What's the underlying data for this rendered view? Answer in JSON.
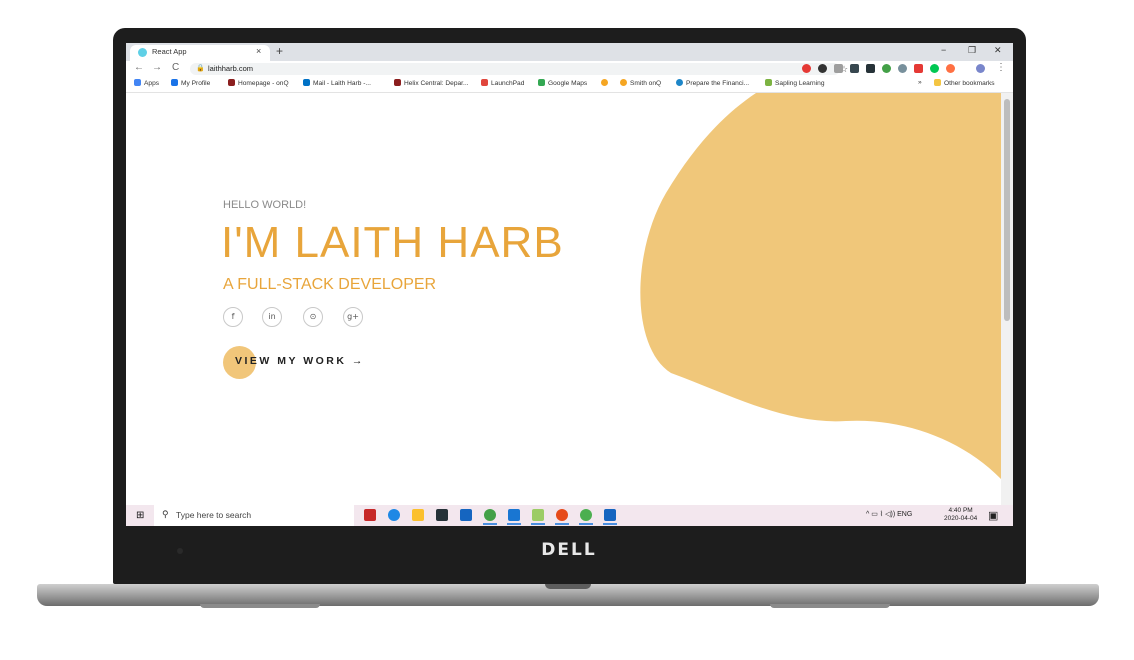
{
  "device": {
    "brand": "DELL"
  },
  "browser": {
    "tab_title": "React App",
    "tab_close": "×",
    "new_tab": "+",
    "window_controls": {
      "minimize": "−",
      "restore": "❐",
      "close": "✕"
    },
    "nav": {
      "back": "←",
      "forward": "→",
      "reload": "C"
    },
    "url": "laithharb.com",
    "bookmarks": [
      {
        "label": "Apps",
        "color": "#4285f4"
      },
      {
        "label": "My Profile",
        "color": "#1a73e8"
      },
      {
        "label": "Homepage - onQ",
        "color": "#8b1e1e"
      },
      {
        "label": "Mail - Laith Harb -...",
        "color": "#0072c6"
      },
      {
        "label": "Helix Central: Depar...",
        "color": "#8b1e1e"
      },
      {
        "label": "LaunchPad",
        "color": "#e0463c"
      },
      {
        "label": "Google Maps",
        "color": "#34a853"
      },
      {
        "label": "Smith onQ",
        "color": "#f5a623"
      },
      {
        "label": "Prepare the Financi...",
        "color": "#1d86c8"
      },
      {
        "label": "Sapling Learning",
        "color": "#7cb342"
      }
    ],
    "bookmarks_more": "»",
    "other_bookmarks": "Other bookmarks",
    "other_bookmarks_color": "#f4c542"
  },
  "page": {
    "greeting": "HELLO WORLD!",
    "name": "I'M LAITH HARB",
    "role": "A FULL-STACK DEVELOPER",
    "social": [
      {
        "icon": "facebook-icon",
        "glyph": "f"
      },
      {
        "icon": "linkedin-icon",
        "glyph": "in"
      },
      {
        "icon": "github-icon",
        "glyph": "⊙"
      },
      {
        "icon": "google-plus-icon",
        "glyph": "g+"
      }
    ],
    "cta": "VIEW MY WORK",
    "cta_arrow": "→",
    "accent_color": "#e8a53b",
    "blob_color": "#f0c77a"
  },
  "taskbar": {
    "search_placeholder": "Type here to search",
    "tray": "^  ▭  ⌇  ◁))  ENG",
    "time": "4:40 PM",
    "date": "2020-04-04"
  }
}
